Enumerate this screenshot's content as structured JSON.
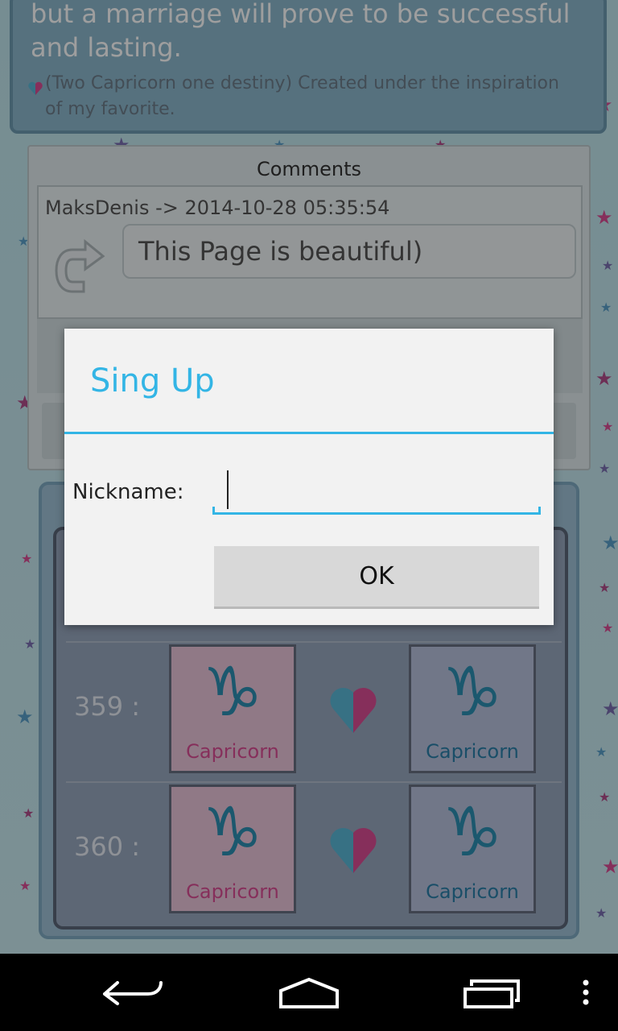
{
  "story": {
    "text": "but a marriage will prove to be successful and lasting.",
    "subtitle": "(Two Capricorn one destiny) Created under the inspiration of my favorite."
  },
  "comments": {
    "title": "Comments",
    "items": [
      {
        "meta": "MaksDenis -> 2014-10-28 05:35:54",
        "text": "This Page is beautiful)"
      }
    ]
  },
  "matches": {
    "rows": [
      {
        "number": "359 :",
        "left_sign": "Capricorn",
        "right_sign": "Capricorn"
      },
      {
        "number": "360 :",
        "left_sign": "Capricorn",
        "right_sign": "Capricorn"
      }
    ]
  },
  "dialog": {
    "title": "Sing Up",
    "nickname_label": "Nickname:",
    "nickname_value": "",
    "ok_label": "OK"
  },
  "icons": {
    "capricorn": "♑",
    "heart": "split-heart-icon"
  },
  "colors": {
    "accent": "#33b5e5",
    "pink": "#d84d94",
    "blue": "#2c8fb2"
  }
}
